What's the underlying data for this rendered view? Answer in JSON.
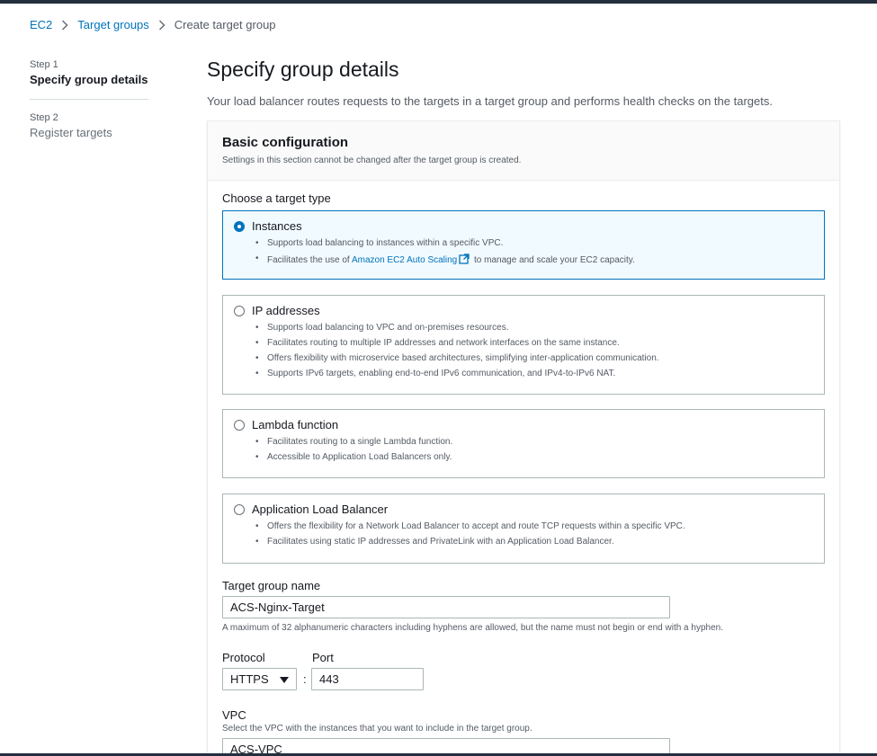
{
  "breadcrumb": {
    "items": [
      {
        "label": "EC2"
      },
      {
        "label": "Target groups"
      }
    ],
    "current": "Create target group"
  },
  "steps": [
    {
      "step_label": "Step 1",
      "title": "Specify group details"
    },
    {
      "step_label": "Step 2",
      "title": "Register targets"
    }
  ],
  "page": {
    "title": "Specify group details",
    "description": "Your load balancer routes requests to the targets in a target group and performs health checks on the targets."
  },
  "basic_config": {
    "title": "Basic configuration",
    "description": "Settings in this section cannot be changed after the target group is created.",
    "target_type_label": "Choose a target type",
    "selected_option": "Instances",
    "options": [
      {
        "title": "Instances",
        "bullets": [
          "Supports load balancing to instances within a specific VPC."
        ],
        "bullet2_prefix": "Facilitates the use of ",
        "bullet2_link": "Amazon EC2 Auto Scaling",
        "bullet2_suffix": " to manage and scale your EC2 capacity."
      },
      {
        "title": "IP addresses",
        "bullets": [
          "Supports load balancing to VPC and on-premises resources.",
          "Facilitates routing to multiple IP addresses and network interfaces on the same instance.",
          "Offers flexibility with microservice based architectures, simplifying inter-application communication.",
          "Supports IPv6 targets, enabling end-to-end IPv6 communication, and IPv4-to-IPv6 NAT."
        ]
      },
      {
        "title": "Lambda function",
        "bullets": [
          "Facilitates routing to a single Lambda function.",
          "Accessible to Application Load Balancers only."
        ]
      },
      {
        "title": "Application Load Balancer",
        "bullets": [
          "Offers the flexibility for a Network Load Balancer to accept and route TCP requests within a specific VPC.",
          "Facilitates using static IP addresses and PrivateLink with an Application Load Balancer."
        ]
      }
    ],
    "name_field": {
      "label": "Target group name",
      "value": "ACS-Nginx-Target",
      "hint": "A maximum of 32 alphanumeric characters including hyphens are allowed, but the name must not begin or end with a hyphen."
    },
    "protocol": {
      "label": "Protocol",
      "value": "HTTPS"
    },
    "port": {
      "label": "Port",
      "value": "443",
      "separator": ":"
    },
    "vpc": {
      "label": "VPC",
      "hint": "Select the VPC with the instances that you want to include in the target group.",
      "value": "ACS-VPC"
    }
  },
  "colors": {
    "link": "#0073bb",
    "selected_bg": "#f1faff",
    "header_bar": "#232f3e"
  }
}
